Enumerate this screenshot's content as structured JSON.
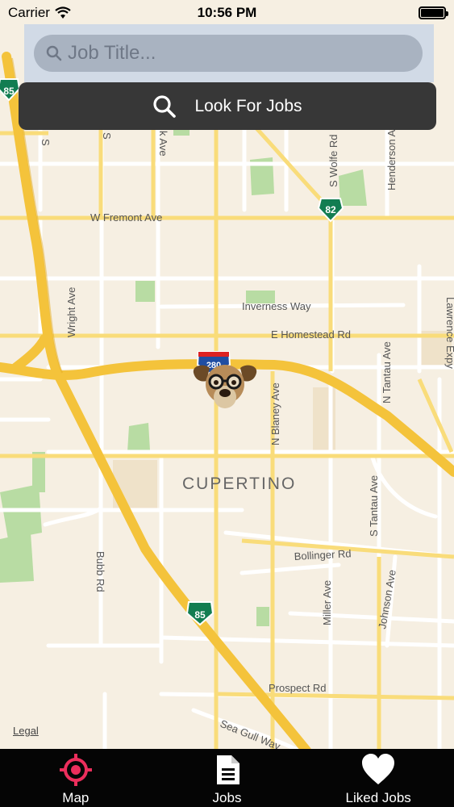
{
  "status_bar": {
    "carrier": "Carrier",
    "time": "10:56 PM",
    "battery_level": 1.0
  },
  "search": {
    "placeholder": "Job Title...",
    "value": "",
    "button_label": "Look For Jobs",
    "icon": "search-icon"
  },
  "map": {
    "labels": {
      "w_fremont": "W Fremont Ave",
      "inverness": "Inverness Way",
      "homestead": "E Homestead Rd",
      "cupertino": "CUPERTINO",
      "bollinger": "Bollinger Rd",
      "prospect": "Prospect Rd",
      "sea_gull": "Sea Gull Way",
      "wright": "Wright Ave",
      "blaney": "N Blaney Ave",
      "tantau_n": "N Tantau Ave",
      "tantau_s": "S Tantau Ave",
      "wolfe": "S Wolfe Rd",
      "henderson": "Henderson Ave",
      "lawrence": "Lawrence Expy",
      "bubb": "Bubb Rd",
      "miller": "Miller Ave",
      "johnson": "Johnson Ave",
      "s_top_left": "S",
      "s_top_mid": "S",
      "k_ave": "k Ave"
    },
    "shields": {
      "hwy85_top": "85",
      "hwy82": "82",
      "i280": "280",
      "hwy85_bottom": "85"
    },
    "legal": "Legal",
    "marker_icon": "dog-with-glasses-icon"
  },
  "tabs": [
    {
      "label": "Map",
      "icon": "target-icon",
      "active": true
    },
    {
      "label": "Jobs",
      "icon": "document-icon",
      "active": false
    },
    {
      "label": "Liked Jobs",
      "icon": "heart-icon",
      "active": false
    }
  ],
  "colors": {
    "map_background": "#f6efe2",
    "highway": "#f7c844",
    "street": "#ffffff",
    "park": "#b8dca3",
    "tab_active": "#ec2e5c",
    "button_bg": "#373737"
  }
}
